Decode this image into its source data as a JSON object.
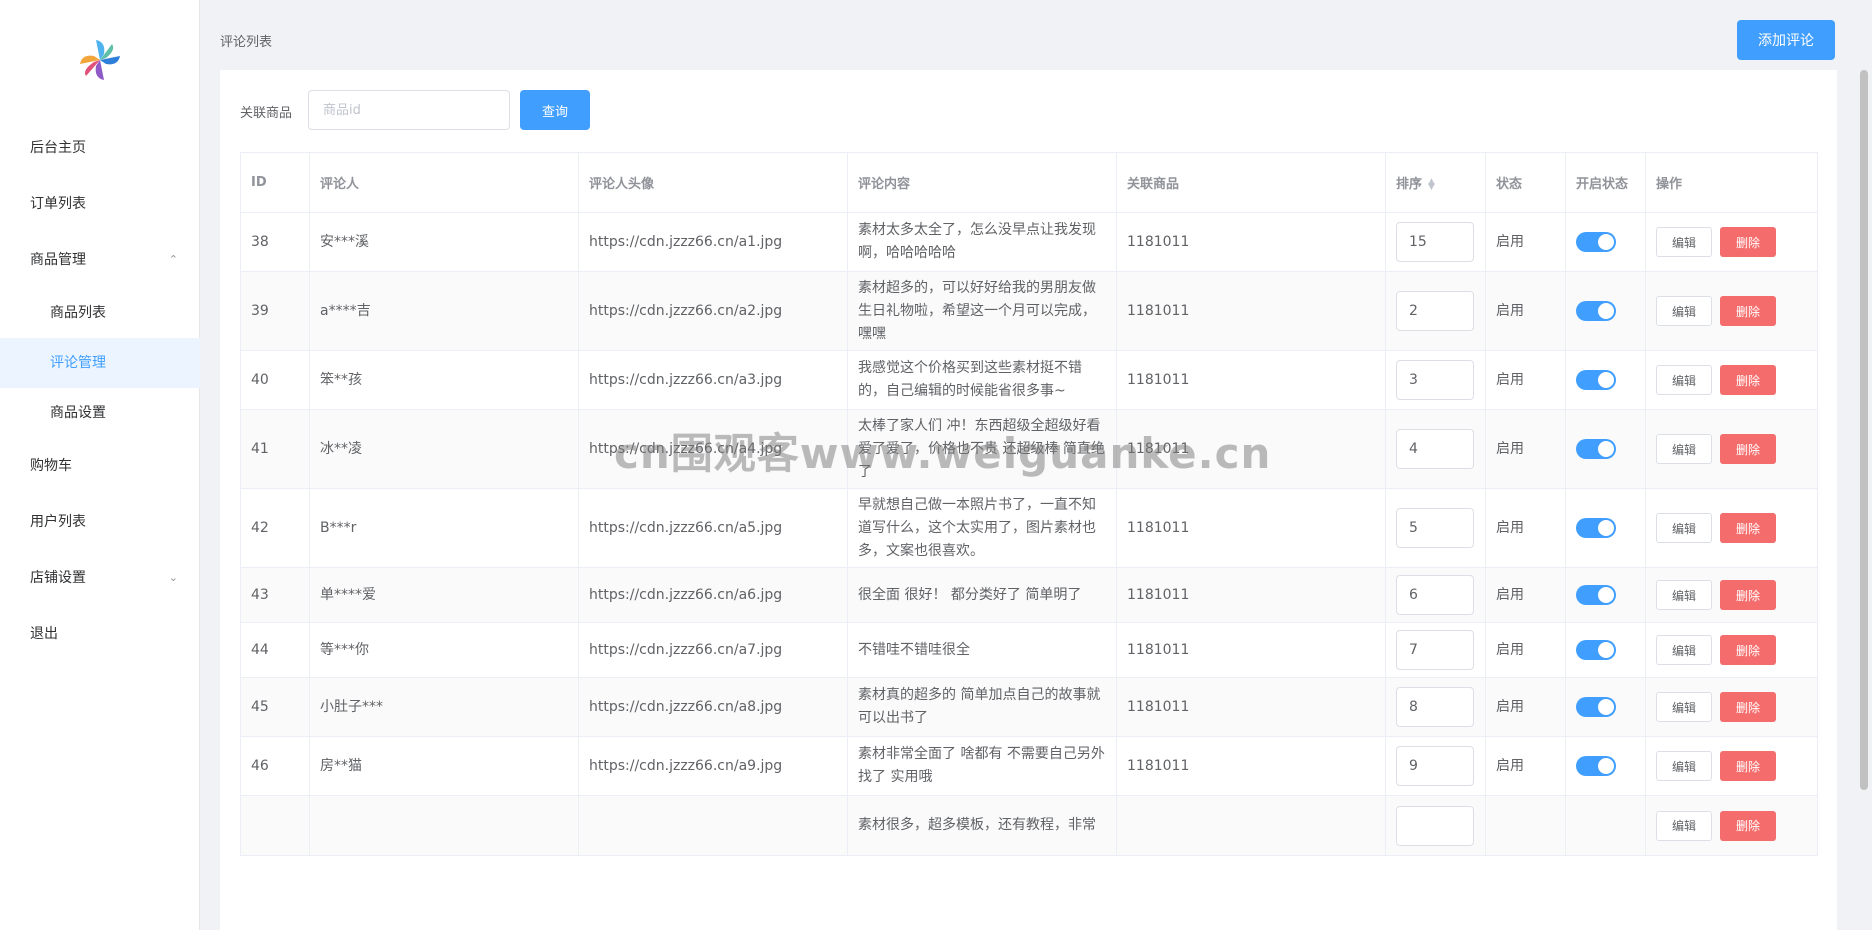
{
  "sidebar": {
    "items": [
      {
        "label": "后台主页"
      },
      {
        "label": "订单列表"
      },
      {
        "label": "商品管理",
        "expanded": true,
        "children": [
          {
            "label": "商品列表"
          },
          {
            "label": "评论管理",
            "active": true
          },
          {
            "label": "商品设置"
          }
        ]
      },
      {
        "label": "购物车"
      },
      {
        "label": "用户列表"
      },
      {
        "label": "店铺设置",
        "expanded": false
      },
      {
        "label": "退出"
      }
    ]
  },
  "header": {
    "title": "评论列表",
    "add_button": "添加评论"
  },
  "filter": {
    "label": "关联商品",
    "placeholder": "商品id",
    "query_button": "查询"
  },
  "table": {
    "columns": [
      "ID",
      "评论人",
      "评论人头像",
      "评论内容",
      "关联商品",
      "排序",
      "状态",
      "开启状态",
      "操作"
    ],
    "edit_label": "编辑",
    "delete_label": "删除",
    "rows": [
      {
        "id": "38",
        "name": "安***溪",
        "avatar": "https://cdn.jzzz66.cn/a1.jpg",
        "content": "素材太多太全了，怎么没早点让我发现啊，哈哈哈哈哈",
        "product": "1181011",
        "sort": "15",
        "status": "启用",
        "enabled": true
      },
      {
        "id": "39",
        "name": "a****吉",
        "avatar": "https://cdn.jzzz66.cn/a2.jpg",
        "content": "素材超多的，可以好好给我的男朋友做生日礼物啦，希望这一个月可以完成，嘿嘿",
        "product": "1181011",
        "sort": "2",
        "status": "启用",
        "enabled": true
      },
      {
        "id": "40",
        "name": "笨**孩",
        "avatar": "https://cdn.jzzz66.cn/a3.jpg",
        "content": "我感觉这个价格买到这些素材挺不错的，自己编辑的时候能省很多事~",
        "product": "1181011",
        "sort": "3",
        "status": "启用",
        "enabled": true
      },
      {
        "id": "41",
        "name": "冰**凌",
        "avatar": "https://cdn.jzzz66.cn/a4.jpg",
        "content": "太棒了家人们 冲！东西超级全超级好看 爱了爱了，价格也不贵 还超级棒 简直绝了",
        "product": "1181011",
        "sort": "4",
        "status": "启用",
        "enabled": true
      },
      {
        "id": "42",
        "name": "B***r",
        "avatar": "https://cdn.jzzz66.cn/a5.jpg",
        "content": "早就想自己做一本照片书了，一直不知道写什么，这个太实用了，图片素材也多，文案也很喜欢。",
        "product": "1181011",
        "sort": "5",
        "status": "启用",
        "enabled": true
      },
      {
        "id": "43",
        "name": "单****爱",
        "avatar": "https://cdn.jzzz66.cn/a6.jpg",
        "content": "很全面 很好！ 都分类好了 简单明了",
        "product": "1181011",
        "sort": "6",
        "status": "启用",
        "enabled": true
      },
      {
        "id": "44",
        "name": "等***你",
        "avatar": "https://cdn.jzzz66.cn/a7.jpg",
        "content": "不错哇不错哇很全",
        "product": "1181011",
        "sort": "7",
        "status": "启用",
        "enabled": true
      },
      {
        "id": "45",
        "name": "小肚子***",
        "avatar": "https://cdn.jzzz66.cn/a8.jpg",
        "content": "素材真的超多的 简单加点自己的故事就可以出书了",
        "product": "1181011",
        "sort": "8",
        "status": "启用",
        "enabled": true
      },
      {
        "id": "46",
        "name": "房**猫",
        "avatar": "https://cdn.jzzz66.cn/a9.jpg",
        "content": "素材非常全面了 啥都有 不需要自己另外找了 实用哦",
        "product": "1181011",
        "sort": "9",
        "status": "启用",
        "enabled": true
      },
      {
        "id": "",
        "name": "",
        "avatar": "",
        "content": "素材很多，超多模板，还有教程，非常",
        "product": "",
        "sort": "",
        "status": "",
        "enabled": false
      }
    ]
  },
  "watermark": "cn围观客www.weiguanke.cn",
  "colors": {
    "primary": "#409eff",
    "danger": "#f56c6c",
    "active_bg": "#ecf5ff"
  }
}
